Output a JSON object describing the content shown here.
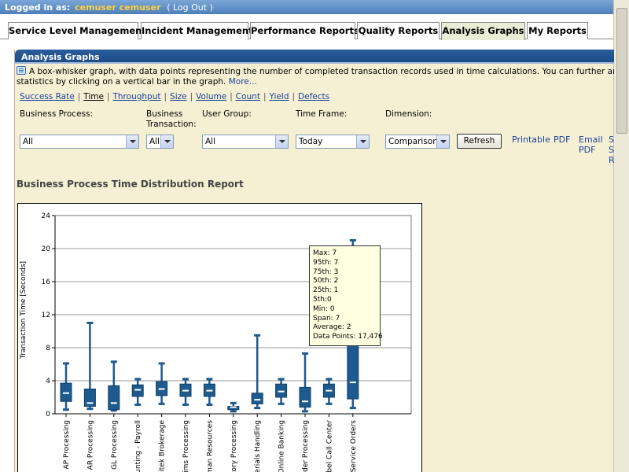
{
  "header": {
    "logged_in_label": "Logged in as:",
    "user": "cemuser cemuser",
    "logout": "( Log Out )"
  },
  "tabs": [
    {
      "label": "Service Level Management"
    },
    {
      "label": "Incident Management"
    },
    {
      "label": "Performance Reports"
    },
    {
      "label": "Quality Reports"
    },
    {
      "label": "Analysis Graphs",
      "active": true
    },
    {
      "label": "My Reports"
    }
  ],
  "panel": {
    "title": "Analysis Graphs",
    "description_line1": "A box-whisker graph, with data points representing the number of completed transaction records used in time calculations. You can further analyze defect",
    "description_line2": "statistics by clicking on a vertical bar in the graph.",
    "more_link": "More..."
  },
  "metrics": [
    "Success Rate",
    "Time",
    "Throughput",
    "Size",
    "Volume",
    "Count",
    "Yield",
    "Defects"
  ],
  "filters": {
    "business_process": {
      "label": "Business Process:",
      "value": "All"
    },
    "business_transaction": {
      "label1": "Business",
      "label2": "Transaction:",
      "value": "All"
    },
    "user_group": {
      "label": "User Group:",
      "value": "All"
    },
    "time_frame": {
      "label": "Time Frame:",
      "value": "Today"
    },
    "dimension": {
      "label": "Dimension:",
      "value": "Comparison"
    },
    "refresh": "Refresh"
  },
  "actions": {
    "printable": "Printable",
    "pdf": "PDF",
    "email_pdf_1": "Email",
    "email_pdf_2": "PDF",
    "cut_1": "S",
    "cut_2": "S",
    "cut_3": "R"
  },
  "report_title": "Business Process Time Distribution Report",
  "chart_data": {
    "type": "box-whisker",
    "ylabel": "Transaction Time [Seconds]",
    "ylim": [
      0,
      24
    ],
    "yticks": [
      0,
      4,
      8,
      12,
      16,
      20,
      24
    ],
    "grid": true,
    "categories": [
      "g - AP Processing",
      "g - AR Processing",
      "g - GL Processing",
      "ounting - Payroll",
      "Avitek Brokerage",
      "Claims Processing",
      "Human Resources",
      "entory Processing",
      "aterials Handling",
      "Online Banking",
      "Order Processing",
      "iebel Call Center",
      "el Service Orders"
    ],
    "series": [
      {
        "min": 0.5,
        "q1": 1.5,
        "median": 2.5,
        "q3": 3.7,
        "max": 6.1
      },
      {
        "min": 0.6,
        "q1": 0.9,
        "median": 1.3,
        "q3": 3.0,
        "max": 11.0
      },
      {
        "min": 0.4,
        "q1": 0.5,
        "median": 1.3,
        "q3": 3.4,
        "max": 6.3
      },
      {
        "min": 1.1,
        "q1": 2.1,
        "median": 2.9,
        "q3": 3.5,
        "max": 4.2
      },
      {
        "min": 1.2,
        "q1": 2.2,
        "median": 3.0,
        "q3": 3.9,
        "max": 6.1
      },
      {
        "min": 1.1,
        "q1": 2.1,
        "median": 2.8,
        "q3": 3.6,
        "max": 4.2
      },
      {
        "min": 1.1,
        "q1": 2.1,
        "median": 2.8,
        "q3": 3.6,
        "max": 4.2
      },
      {
        "min": 0.3,
        "q1": 0.5,
        "median": 0.8,
        "q3": 0.9,
        "max": 1.3
      },
      {
        "min": 0.7,
        "q1": 1.2,
        "median": 1.7,
        "q3": 2.5,
        "max": 9.5
      },
      {
        "min": 1.2,
        "q1": 2.0,
        "median": 2.7,
        "q3": 3.6,
        "max": 4.2
      },
      {
        "min": 0.3,
        "q1": 0.8,
        "median": 1.5,
        "q3": 3.2,
        "max": 7.3
      },
      {
        "min": 1.2,
        "q1": 2.0,
        "median": 2.8,
        "q3": 3.6,
        "max": 4.2
      },
      {
        "min": 0.7,
        "q1": 1.8,
        "median": 3.8,
        "q3": 20.0,
        "max": 21.0
      }
    ],
    "color": "#1e5a8e"
  },
  "tooltip": [
    "Max: 7",
    "95th: 7",
    "75th: 3",
    "50th: 2",
    "25th: 1",
    "5th:0",
    "Min: 0",
    "Span: 7",
    "Average: 2",
    "Data Points: 17,476"
  ]
}
